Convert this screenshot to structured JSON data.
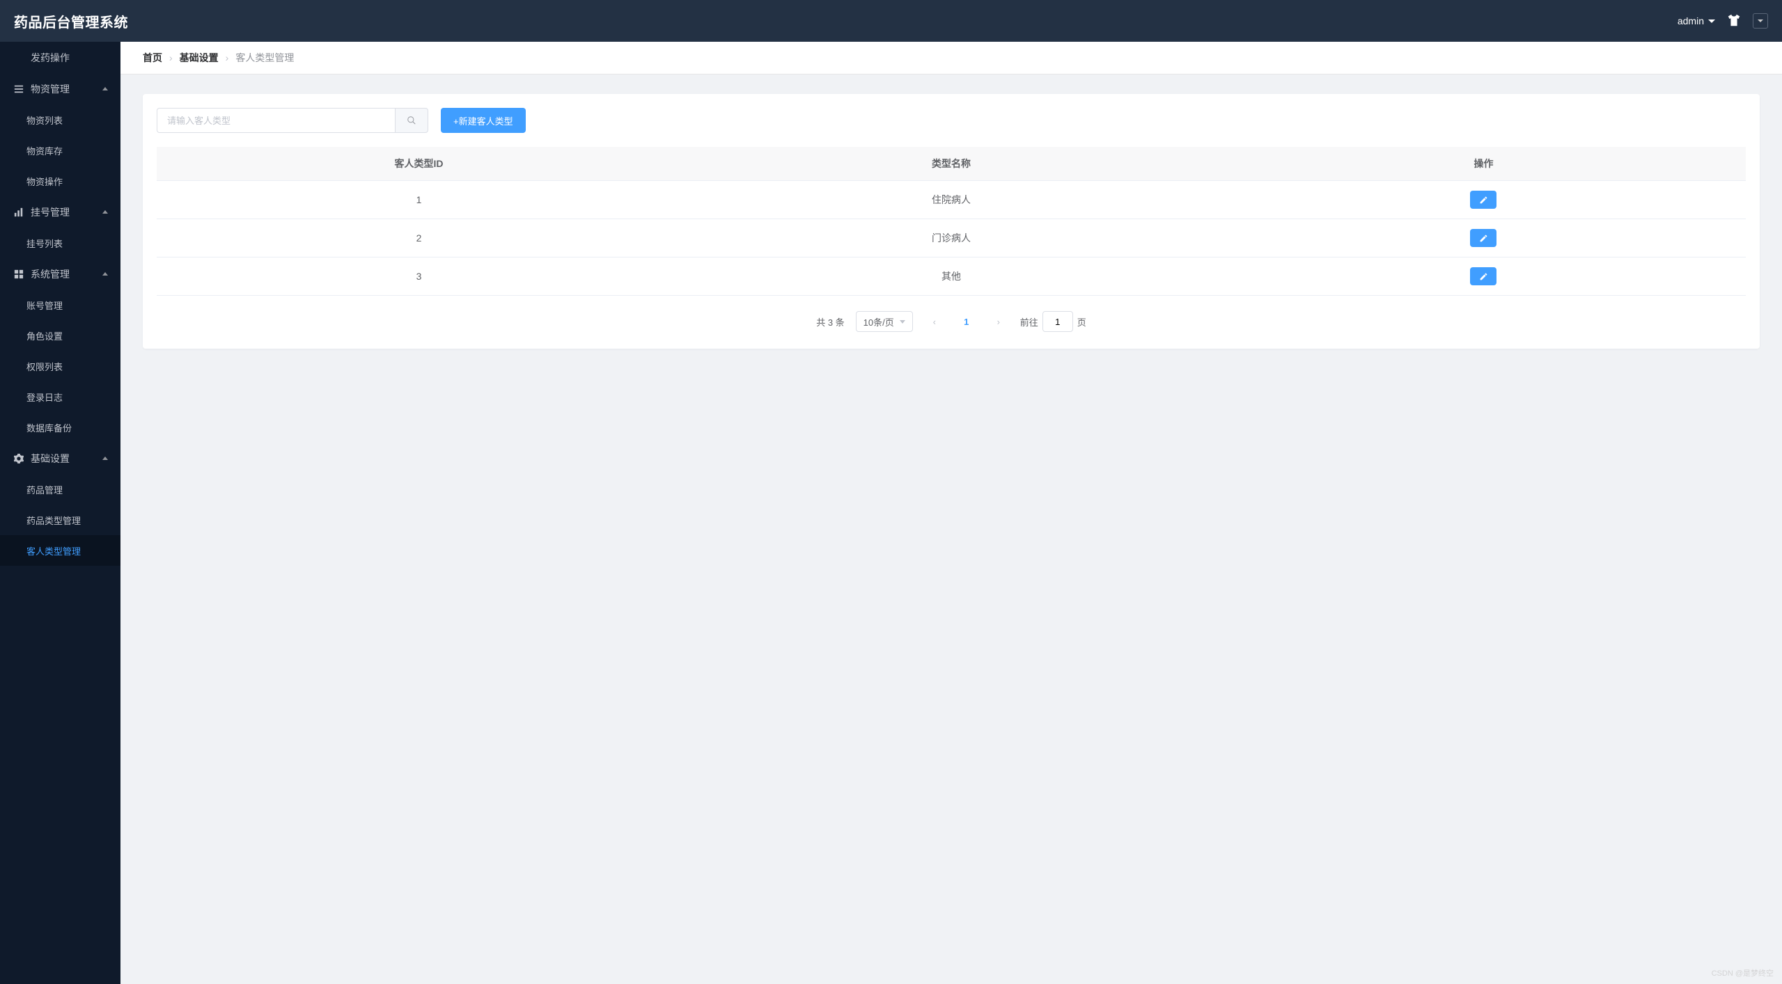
{
  "app": {
    "title": "药品后台管理系统"
  },
  "header": {
    "user": "admin"
  },
  "sidebar": {
    "items": [
      {
        "label": "发药操作",
        "icon": null,
        "children": null
      },
      {
        "label": "物资管理",
        "icon": "bars",
        "expanded": true,
        "children": [
          {
            "label": "物资列表"
          },
          {
            "label": "物资库存"
          },
          {
            "label": "物资操作"
          }
        ]
      },
      {
        "label": "挂号管理",
        "icon": "chart",
        "expanded": true,
        "children": [
          {
            "label": "挂号列表"
          }
        ]
      },
      {
        "label": "系统管理",
        "icon": "grid",
        "expanded": true,
        "children": [
          {
            "label": "账号管理"
          },
          {
            "label": "角色设置"
          },
          {
            "label": "权限列表"
          },
          {
            "label": "登录日志"
          },
          {
            "label": "数据库备份"
          }
        ]
      },
      {
        "label": "基础设置",
        "icon": "gear",
        "expanded": true,
        "children": [
          {
            "label": "药品管理"
          },
          {
            "label": "药品类型管理"
          },
          {
            "label": "客人类型管理",
            "active": true
          }
        ]
      }
    ]
  },
  "breadcrumb": [
    "首页",
    "基础设置",
    "客人类型管理"
  ],
  "toolbar": {
    "search_placeholder": "请输入客人类型",
    "create_label": "+新建客人类型"
  },
  "table": {
    "columns": [
      "客人类型ID",
      "类型名称",
      "操作"
    ],
    "rows": [
      {
        "id": "1",
        "name": "住院病人"
      },
      {
        "id": "2",
        "name": "门诊病人"
      },
      {
        "id": "3",
        "name": "其他"
      }
    ]
  },
  "pagination": {
    "total_text": "共 3 条",
    "page_size_label": "10条/页",
    "current_page": "1",
    "goto_prefix": "前往",
    "goto_value": "1",
    "goto_suffix": "页"
  },
  "watermark": "CSDN @是梦终空"
}
